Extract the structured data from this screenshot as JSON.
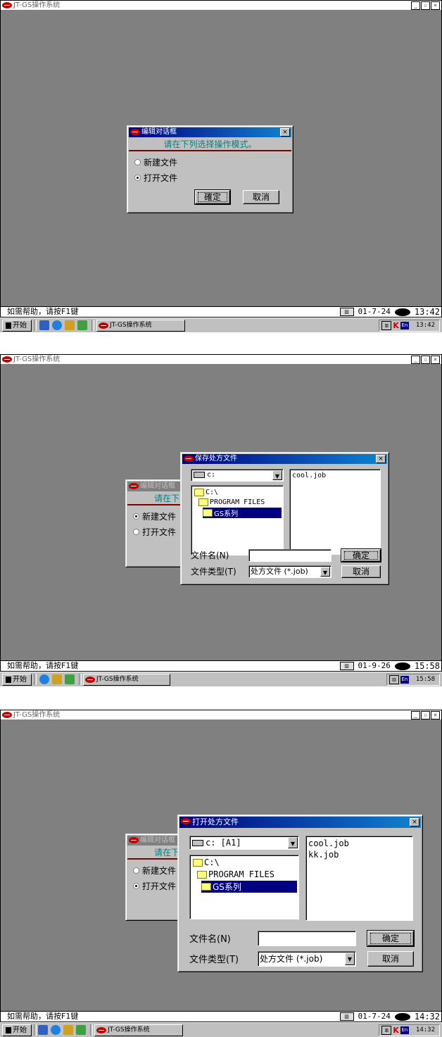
{
  "screen1": {
    "window_title": "JT-GS操作系统",
    "window_buttons": [
      "_",
      "▫",
      "×"
    ],
    "dialog": {
      "title": "编辑对话框",
      "prompt": "请在下列选择操作模式。",
      "options": [
        "新建文件",
        "打开文件"
      ],
      "selected": "打开文件",
      "ok": "確定",
      "cancel": "取消"
    },
    "status": {
      "help": "如需帮助，请按F1键",
      "date": "01-7-24",
      "time": "13:42"
    },
    "taskbar": {
      "start": "开始",
      "task": "JT-GS操作系统",
      "tray_time": "13:42",
      "tray_k": "K",
      "tray_en": "En"
    }
  },
  "screen2": {
    "window_title": "JT-GS操作系统",
    "window_buttons": [
      "_",
      "▫",
      "×"
    ],
    "bg_dialog": {
      "title": "编辑对话框",
      "prompt": "请在下",
      "options": [
        "新建文件",
        "打开文件"
      ],
      "selected": "新建文件"
    },
    "file_dialog": {
      "title": "保存处方文件",
      "drive": "c:",
      "tree": [
        "C:\\",
        "PROGRAM FILES",
        "GS系列"
      ],
      "files": [
        "cool.job"
      ],
      "filename_label": "文件名(N)",
      "filetype_label": "文件类型(T)",
      "filetype_value": "处方文件 (*.job)",
      "ok": "确定",
      "cancel": "取消"
    },
    "status": {
      "help": "如需帮助，请按F1键",
      "date": "01-9-26",
      "time": "15:58"
    },
    "taskbar": {
      "start": "开始",
      "task": "JT-GS操作系统",
      "tray_time": "15:58",
      "tray_en": "En"
    }
  },
  "screen3": {
    "window_title": "JT-GS操作系统",
    "window_buttons": [
      "_",
      "▫",
      "×"
    ],
    "bg_dialog": {
      "title": "编辑对话框",
      "prompt": "请在下",
      "options": [
        "新建文件",
        "打开文件"
      ],
      "selected": "打开文件"
    },
    "file_dialog": {
      "title": "打开处方文件",
      "drive": "c: [A1]",
      "tree": [
        "C:\\",
        "PROGRAM FILES",
        "GS系列"
      ],
      "files": [
        "cool.job",
        "kk.job"
      ],
      "filename_label": "文件名(N)",
      "filetype_label": "文件类型(T)",
      "filetype_value": "处方文件 (*.job)",
      "ok": "确定",
      "cancel": "取消"
    },
    "status": {
      "help": "如需帮助，请按F1键",
      "date": "01-7-24",
      "time": "14:32"
    },
    "taskbar": {
      "start": "开始",
      "task": "JT-GS操作系统",
      "tray_time": "14:32",
      "tray_k": "K",
      "tray_en": "En"
    }
  }
}
